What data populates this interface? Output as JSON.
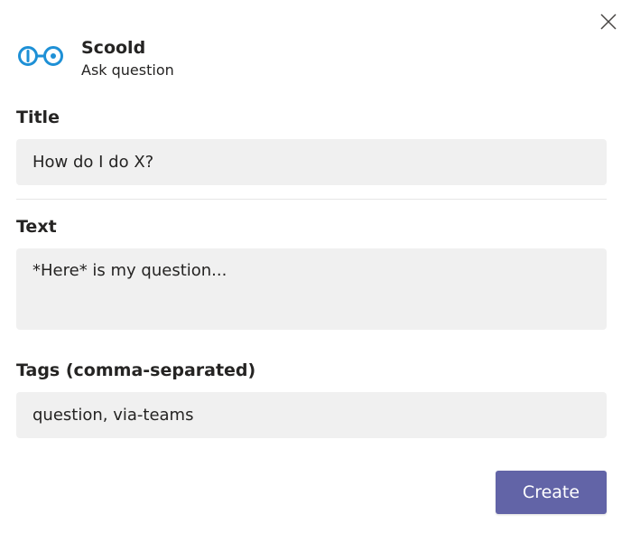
{
  "colors": {
    "accent": "#6264a7",
    "logo": "#1e90d6",
    "input_bg": "#f0f0f0"
  },
  "dialog": {
    "close_icon": "close-icon"
  },
  "header": {
    "app_name": "Scoold",
    "subtitle": "Ask question",
    "logo_icon": "scoold-logo-icon"
  },
  "form": {
    "title": {
      "label": "Title",
      "value": "How do I do X?"
    },
    "text": {
      "label": "Text",
      "value": "*Here* is my question..."
    },
    "tags": {
      "label": "Tags (comma-separated)",
      "value": "question, via-teams"
    }
  },
  "actions": {
    "create_label": "Create"
  }
}
